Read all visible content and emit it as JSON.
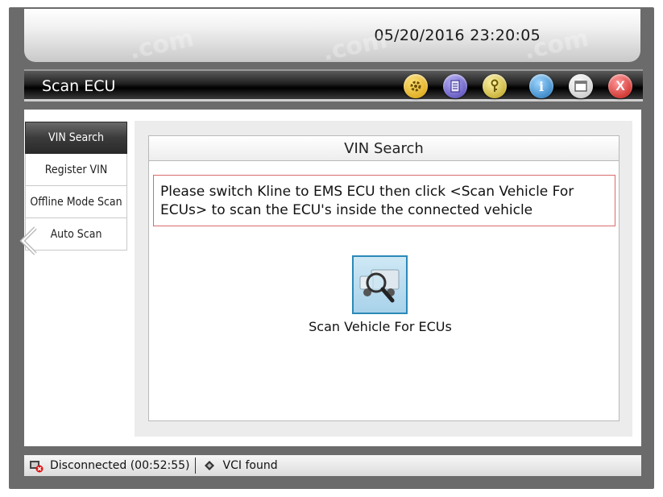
{
  "header": {
    "datetime": "05/20/2016 23:20:05"
  },
  "window": {
    "title": "Scan ECU",
    "buttons": [
      {
        "name": "settings-gear-icon",
        "color": "#e0b21a"
      },
      {
        "name": "document-icon",
        "color": "#6a5fc8"
      },
      {
        "name": "key-icon",
        "color": "#c8b540"
      },
      {
        "name": "info-icon",
        "color": "#2c8fd0"
      },
      {
        "name": "window-icon",
        "color": "#d8d8d8"
      },
      {
        "name": "close-icon",
        "color": "#d22"
      }
    ]
  },
  "sidebar": {
    "items": [
      {
        "label": "VIN Search",
        "active": true
      },
      {
        "label": "Register VIN",
        "active": false
      },
      {
        "label": "Offline Mode Scan",
        "active": false
      },
      {
        "label": "Auto Scan",
        "active": false
      }
    ]
  },
  "panel": {
    "title": "VIN Search",
    "message": "Please switch Kline to EMS ECU then click <Scan Vehicle For ECUs> to scan the ECU's inside the connected vehicle",
    "scan_button_label": "Scan Vehicle For ECUs"
  },
  "status": {
    "connection": "Disconnected (00:52:55)",
    "vci": "VCI found"
  },
  "watermark_text": ".com"
}
